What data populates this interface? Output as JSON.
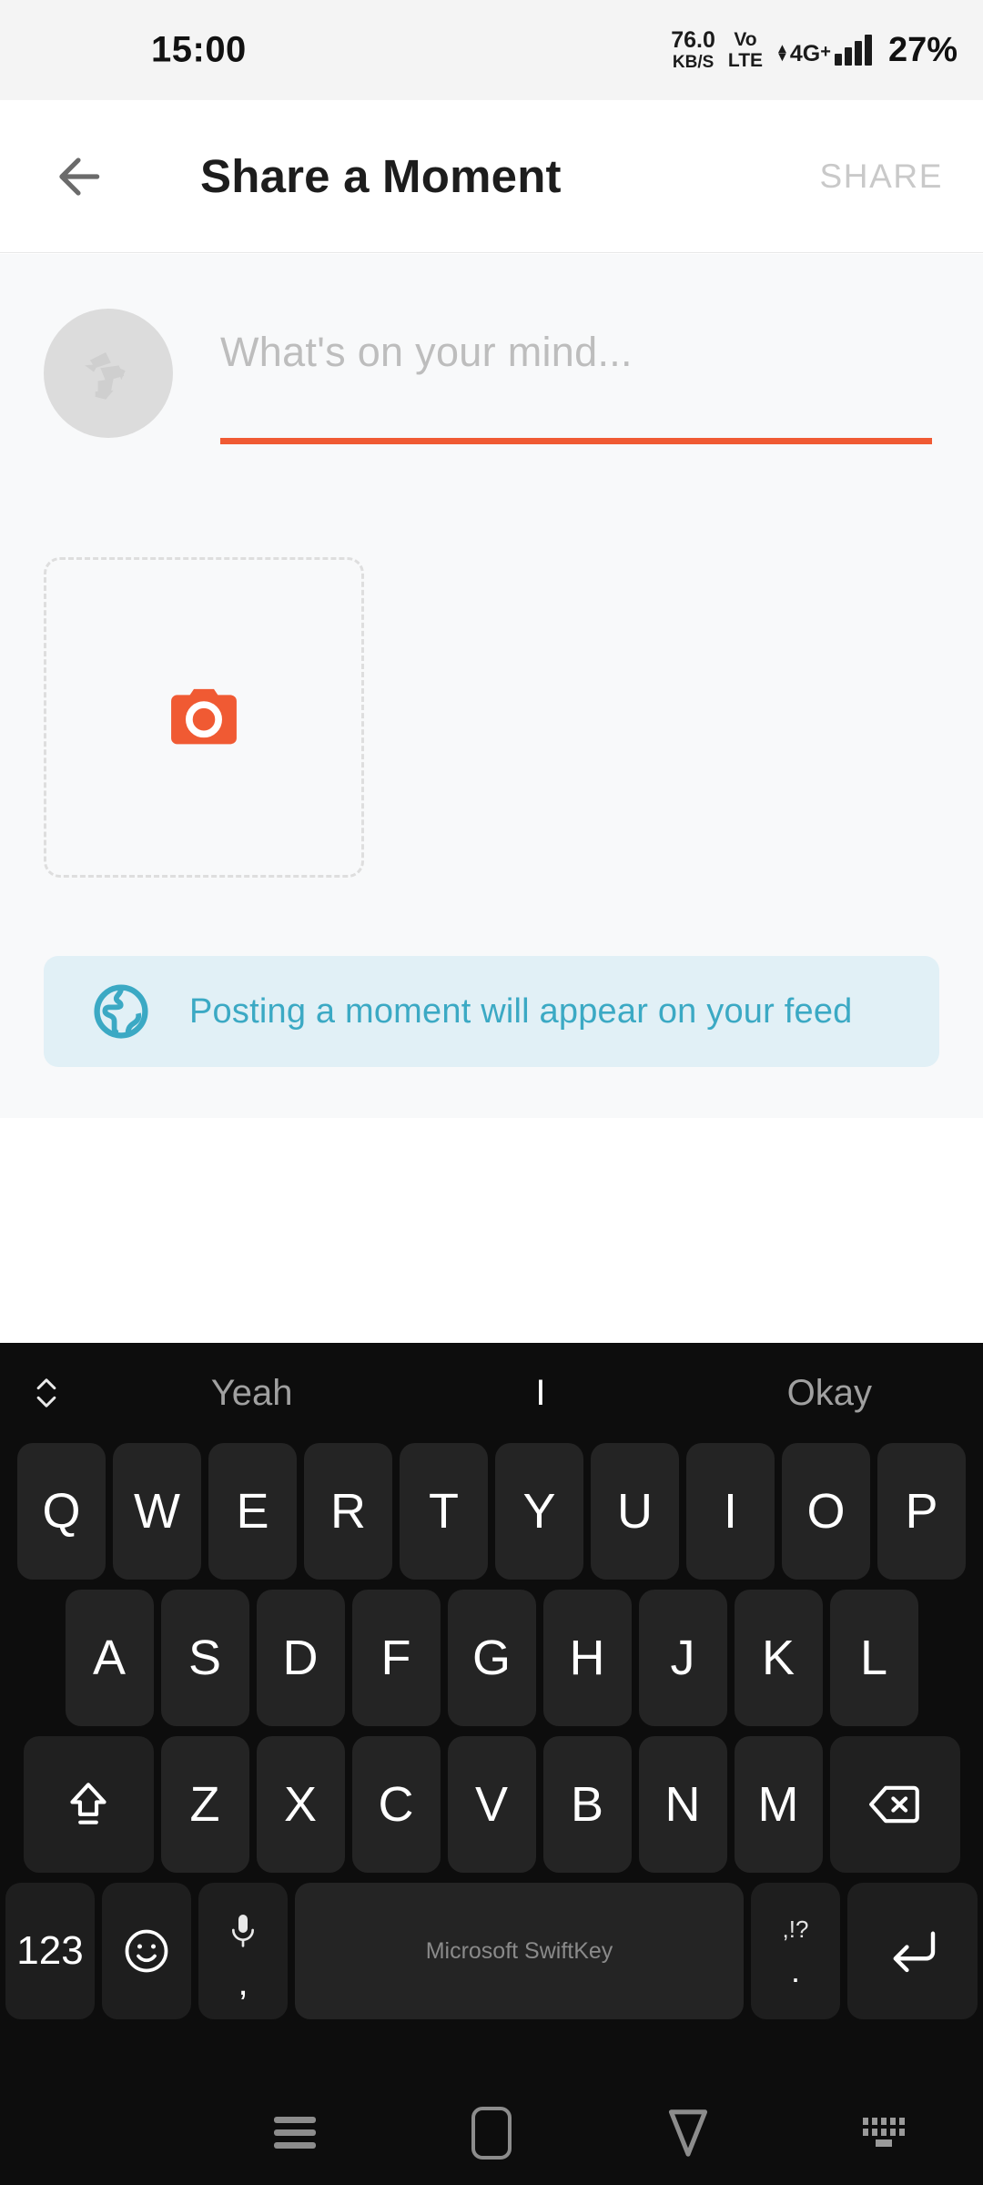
{
  "status_bar": {
    "time": "15:00",
    "network_speed_value": "76.0",
    "network_speed_unit": "KB/S",
    "volte_line1": "Vo",
    "volte_line2": "LTE",
    "network_type": "4G",
    "network_type_plus": "+",
    "battery_percent": "27%"
  },
  "app_bar": {
    "back_icon": "arrow-left-icon",
    "title": "Share a Moment",
    "share_label": "SHARE",
    "share_enabled": false
  },
  "composer": {
    "avatar_icon": "default-avatar-placeholder",
    "placeholder": "What's on your mind...",
    "value": "",
    "underline_color": "#f05a33"
  },
  "photo_picker": {
    "icon": "camera-icon",
    "icon_color": "#f05a33",
    "border_style": "dashed"
  },
  "info_banner": {
    "icon": "globe-icon",
    "text": "Posting a moment will appear on your feed",
    "text_color": "#3ba9c4",
    "background_color": "#e1f0f6"
  },
  "keyboard": {
    "expand_icon": "chevron-up-down-icon",
    "suggestions": [
      "Yeah",
      "I",
      "Okay"
    ],
    "active_suggestion_index": 1,
    "row1": [
      "Q",
      "W",
      "E",
      "R",
      "T",
      "Y",
      "U",
      "I",
      "O",
      "P"
    ],
    "row2": [
      "A",
      "S",
      "D",
      "F",
      "G",
      "H",
      "J",
      "K",
      "L"
    ],
    "row3_letters": [
      "Z",
      "X",
      "C",
      "V",
      "B",
      "N",
      "M"
    ],
    "shift_icon": "shift-icon",
    "backspace_icon": "backspace-icon",
    "numeric_label": "123",
    "emoji_icon": "emoji-smiley-icon",
    "mic_icon": "microphone-icon",
    "mic_secondary": ",",
    "space_label": "Microsoft SwiftKey",
    "punct_top": ",!?",
    "punct_bottom": ".",
    "enter_icon": "enter-return-icon"
  },
  "nav_bar": {
    "recents_icon": "recents-icon",
    "home_icon": "home-icon",
    "back_icon": "back-triangle-icon",
    "hide_keyboard_icon": "hide-keyboard-icon"
  }
}
